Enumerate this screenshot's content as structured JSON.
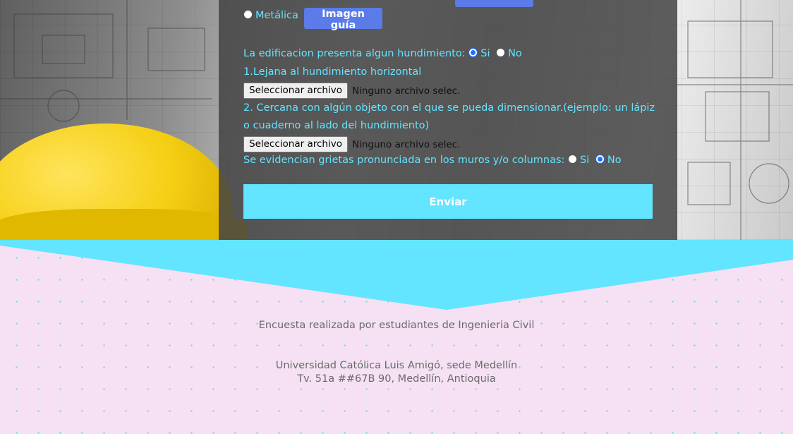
{
  "form": {
    "metalica_label": "Metálica",
    "guide_button": "Imagen guía",
    "sinking_question": "La edificacion presenta algun hundimiento:",
    "sinking_yes": "Si",
    "sinking_no": "No",
    "photo1_label": "1.Lejana al hundimiento horizontal",
    "photo2_label_line1": "2. Cercana con algún objeto con el que se pueda dimensionar.(ejemplo: un lápiz",
    "photo2_label_line2": "o cuaderno al lado del hundimiento)",
    "file_button": "Seleccionar archivo",
    "file_none": "Ninguno archivo selec.",
    "cracks_question": "Se evidencian grietas pronunciada en los muros y/o columnas:",
    "cracks_yes": "Si",
    "cracks_no": "No",
    "submit": "Enviar"
  },
  "footer": {
    "line1": "Encuesta realizada por estudiantes de Ingenieria Civil",
    "line2": "Universidad Católica Luis Amigó, sede Medellín",
    "line3": "Tv. 51a ##67B 90, Medellín, Antioquia"
  },
  "colors": {
    "accent": "#63e4ff",
    "button": "#5b7be8",
    "footer_bg": "#f5e1f3",
    "panel": "#444444"
  }
}
